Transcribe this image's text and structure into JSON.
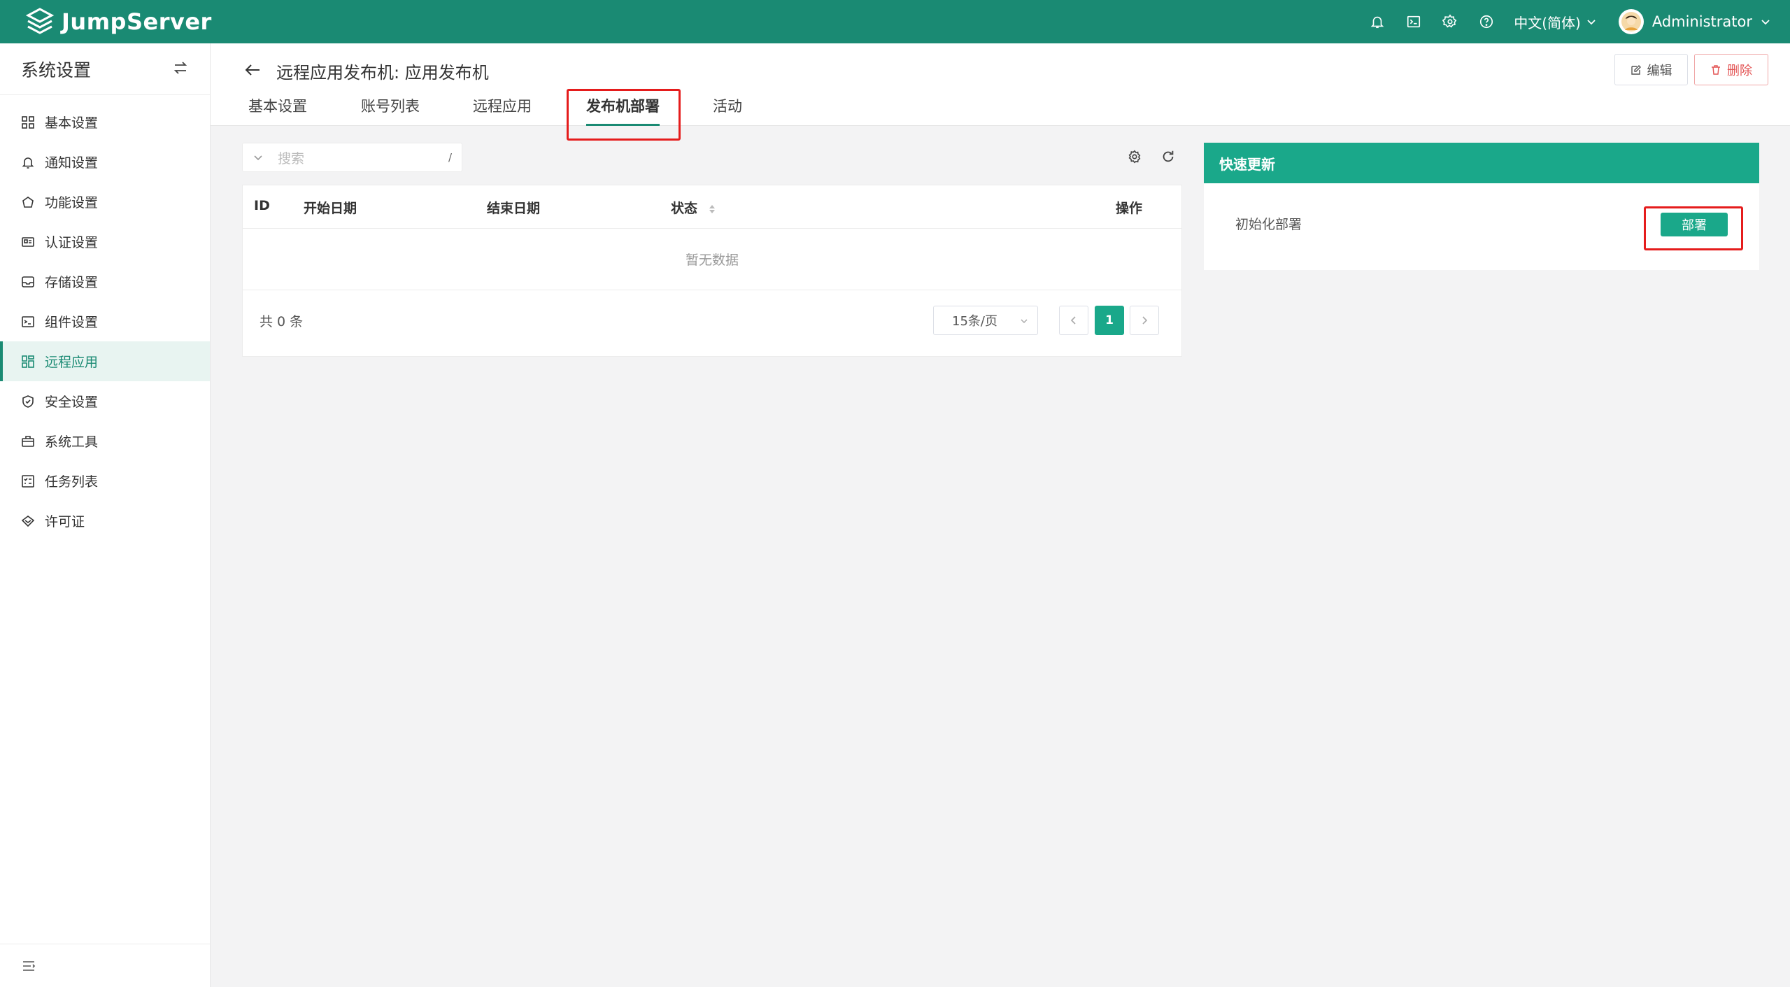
{
  "app": {
    "name": "JumpServer",
    "language": "中文(简体)",
    "user": "Administrator"
  },
  "colors": {
    "brand": "#1a8a73",
    "accent": "#1aa88a",
    "highlight": "#e51c1c",
    "danger": "#e35555"
  },
  "sidebar": {
    "title": "系统设置",
    "items": [
      {
        "label": "基本设置",
        "icon": "grid-icon"
      },
      {
        "label": "通知设置",
        "icon": "bell-icon"
      },
      {
        "label": "功能设置",
        "icon": "feature-icon"
      },
      {
        "label": "认证设置",
        "icon": "id-card-icon"
      },
      {
        "label": "存储设置",
        "icon": "inbox-icon"
      },
      {
        "label": "组件设置",
        "icon": "terminal-icon"
      },
      {
        "label": "远程应用",
        "icon": "apps-icon",
        "active": true
      },
      {
        "label": "安全设置",
        "icon": "shield-icon"
      },
      {
        "label": "系统工具",
        "icon": "toolbox-icon"
      },
      {
        "label": "任务列表",
        "icon": "task-list-icon"
      },
      {
        "label": "许可证",
        "icon": "license-icon"
      }
    ]
  },
  "page": {
    "title": "远程应用发布机: 应用发布机",
    "edit_label": "编辑",
    "delete_label": "删除",
    "tabs": [
      {
        "label": "基本设置"
      },
      {
        "label": "账号列表"
      },
      {
        "label": "远程应用"
      },
      {
        "label": "发布机部署",
        "active": true
      },
      {
        "label": "活动"
      }
    ]
  },
  "search": {
    "placeholder": "搜索",
    "shortcut": "/"
  },
  "table": {
    "columns": [
      "ID",
      "开始日期",
      "结束日期",
      "状态",
      "操作"
    ],
    "empty_text": "暂无数据",
    "total": "共 0 条",
    "page_size": "15条/页",
    "current_page": "1"
  },
  "quick_update": {
    "title": "快速更新",
    "row_label": "初始化部署",
    "button_label": "部署"
  }
}
